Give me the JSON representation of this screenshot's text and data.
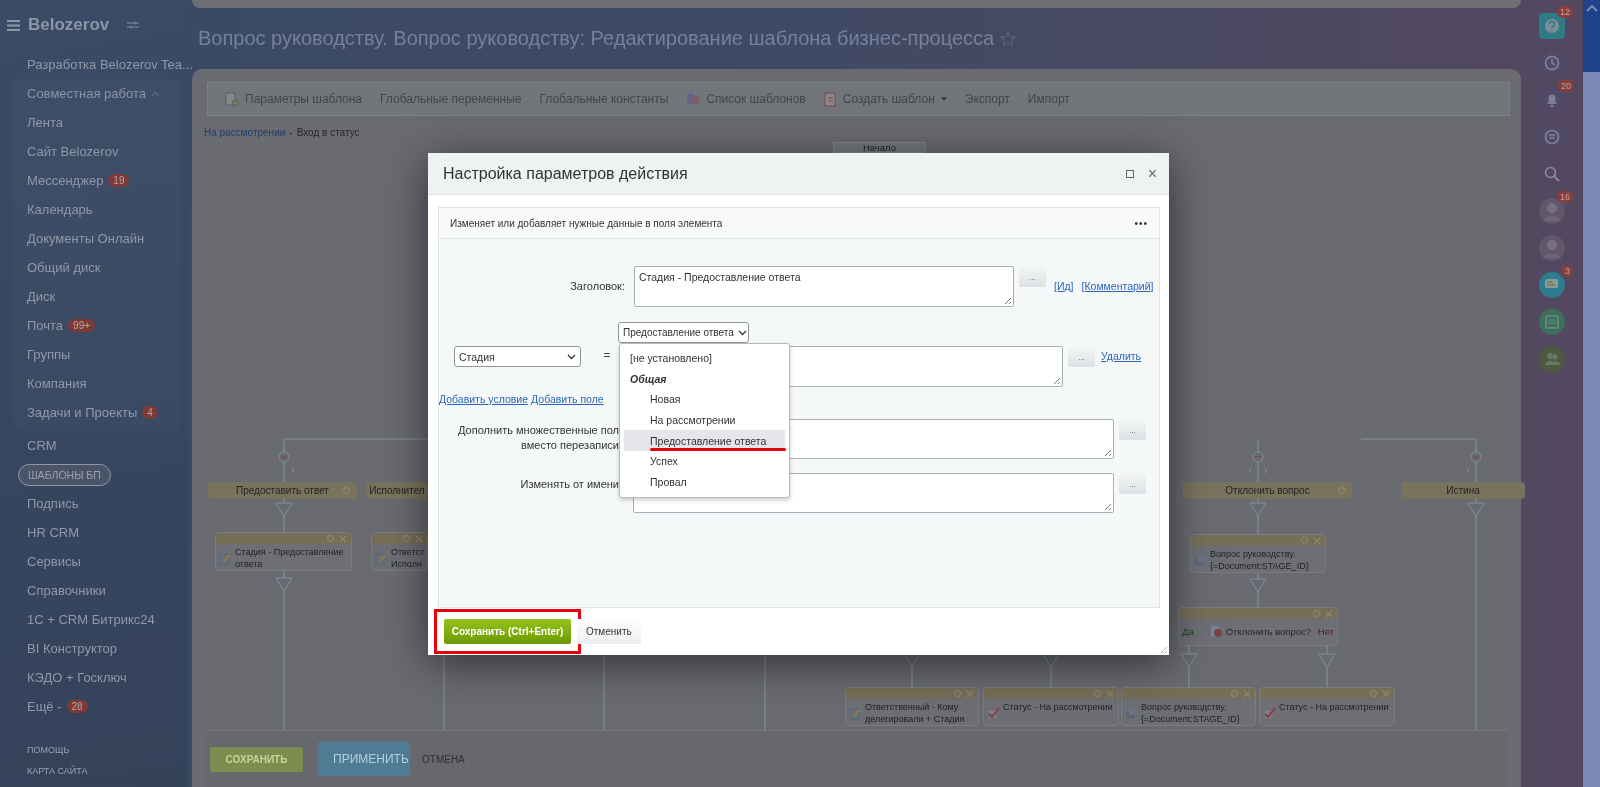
{
  "sidebar": {
    "brand": "Belozerov",
    "items": [
      {
        "label": "Разработка Belozerov Tea...",
        "kind": "item",
        "selected": false
      },
      {
        "label": "Совместная работа",
        "kind": "group",
        "expanded": true,
        "selected": false,
        "children": [
          {
            "label": "Лента",
            "selected": false
          },
          {
            "label": "Сайт Belozerov",
            "selected": false
          },
          {
            "label": "Мессенджер",
            "counter": "19",
            "selected": false
          },
          {
            "label": "Календарь",
            "selected": false
          },
          {
            "label": "Документы Онлайн",
            "selected": false
          },
          {
            "label": "Общий диск",
            "selected": false
          },
          {
            "label": "Диск",
            "selected": false
          },
          {
            "label": "Почта",
            "counter": "99+",
            "selected": false
          },
          {
            "label": "Группы",
            "selected": false
          },
          {
            "label": "Компания",
            "selected": false
          },
          {
            "label": "Задачи и Проекты",
            "counter": "4",
            "selected": false
          }
        ]
      },
      {
        "label": "CRM",
        "kind": "item",
        "selected": false
      },
      {
        "label": "ШАБЛОНЫ БП",
        "kind": "item",
        "selected": true
      },
      {
        "label": "Подпись",
        "kind": "item",
        "selected": false
      },
      {
        "label": "HR CRM",
        "kind": "item",
        "selected": false
      },
      {
        "label": "Сервисы",
        "kind": "item",
        "selected": false
      },
      {
        "label": "Справочники",
        "kind": "item",
        "selected": false
      },
      {
        "label": "1С + CRM Битрикс24",
        "kind": "item",
        "selected": false
      },
      {
        "label": "BI Конструктор",
        "kind": "item",
        "selected": false
      },
      {
        "label": "КЭДО + Госключ",
        "kind": "item",
        "selected": false
      },
      {
        "label": "Ещё -",
        "kind": "item",
        "counter": "28",
        "selected": false
      }
    ],
    "footer": [
      "ПОМОЩЬ",
      "КАРТА САЙТА"
    ]
  },
  "page_title": "Вопрос руководству. Вопрос руководству: Редактирование шаблона бизнес-процесса",
  "toolbar": [
    {
      "label": "Параметры шаблона",
      "kind": "settings"
    },
    {
      "label": "Глобальные переменные",
      "kind": "plain"
    },
    {
      "label": "Глобальные константы",
      "kind": "plain"
    },
    {
      "label": "Список шаблонов",
      "kind": "list"
    },
    {
      "label": "Создать шаблон",
      "kind": "create",
      "dropdown": true
    },
    {
      "label": "Экспорт",
      "kind": "plain"
    },
    {
      "label": "Импорт",
      "kind": "plain"
    }
  ],
  "breadcrumb": {
    "link": "На рассмотрении",
    "separator": "-",
    "current": "Вход в статус"
  },
  "workflow": {
    "nodes": [
      {
        "kind": "start",
        "label": "Начало"
      },
      {
        "kind": "branch",
        "label": "Предоставить ответ",
        "settings": true
      },
      {
        "kind": "branch",
        "label": "Исполнител",
        "settings": false
      },
      {
        "kind": "branch",
        "label": "Отклонить вопрос",
        "settings": true
      },
      {
        "kind": "branch",
        "label": "Истина",
        "settings": false
      },
      {
        "kind": "field-activity",
        "lines": [
          "Стадия - Предоставление",
          "ответа"
        ]
      },
      {
        "kind": "field-activity",
        "lines": [
          "Ответст",
          "Исполн"
        ]
      },
      {
        "kind": "message-activity",
        "lines": [
          "Вопрос руководству.",
          "{=Document:STAGE_ID}"
        ]
      },
      {
        "kind": "ifelse",
        "yes": "Да",
        "label": "Отклонить вопрос?",
        "no": "Нет"
      },
      {
        "kind": "field-activity",
        "lines": [
          "Ответственный - Кому",
          "делегировали + Стадия"
        ]
      },
      {
        "kind": "status-activity",
        "lines": [
          "Статус - На рассмотрении"
        ]
      },
      {
        "kind": "message-activity",
        "lines": [
          "Вопрос руководству.",
          "{=Document:STAGE_ID}"
        ]
      },
      {
        "kind": "status-activity",
        "lines": [
          "Статус - На рассмотрении"
        ]
      }
    ]
  },
  "bottom_bar": [
    {
      "label": "СОХРАНИТЬ",
      "kind": "save"
    },
    {
      "label": "ПРИМЕНИТЬ",
      "kind": "apply"
    },
    {
      "label": "ОТМЕНА",
      "kind": "cancel"
    }
  ],
  "right_bar": [
    {
      "kind": "help",
      "counter": "12"
    },
    {
      "kind": "timeline"
    },
    {
      "kind": "bell",
      "counter": "20"
    },
    {
      "kind": "chats"
    },
    {
      "kind": "search"
    },
    {
      "kind": "avatar",
      "counter": "16"
    },
    {
      "kind": "avatar"
    },
    {
      "kind": "messenger",
      "counter": "3"
    },
    {
      "kind": "news"
    },
    {
      "kind": "people"
    }
  ],
  "dialog": {
    "title": "Настройка параметров действия",
    "close": "×",
    "description": "Изменяет или добавляет нужные данные в поля элемента",
    "menu": "•••",
    "title_field": {
      "label": "Заголовок:",
      "value": "Стадия - Предоставление ответа",
      "button": "...",
      "links": [
        "[Ид]",
        "[Комментарий]"
      ]
    },
    "value_select": "Предоставление ответа",
    "condition": {
      "field": "Стадия",
      "operator": "=",
      "button": "...",
      "remove": "Удалить"
    },
    "add_links": [
      "Добавить условие",
      "Добавить поле"
    ],
    "extra_fields": [
      {
        "label_lines": [
          "Дополнить множественные пол",
          "вместо перезаписи"
        ],
        "button": "..."
      },
      {
        "label_lines": [
          "Изменять от имени"
        ],
        "button": "..."
      }
    ],
    "dropdown": {
      "options": [
        {
          "label": "[не установлено]",
          "kind": "option",
          "selected": false,
          "underlined": false
        },
        {
          "label": "Общая",
          "kind": "group",
          "selected": false,
          "underlined": false
        },
        {
          "label": "Новая",
          "kind": "suboption",
          "selected": false,
          "underlined": false
        },
        {
          "label": "На рассмотрении",
          "kind": "suboption",
          "selected": false,
          "underlined": false
        },
        {
          "label": "Предоставление ответа",
          "kind": "suboption",
          "selected": true,
          "underlined": true
        },
        {
          "label": "Успех",
          "kind": "suboption",
          "selected": false,
          "underlined": false
        },
        {
          "label": "Провал",
          "kind": "suboption",
          "selected": false,
          "underlined": false
        }
      ]
    },
    "save": {
      "label": "Сохранить (Ctrl+Enter)",
      "highlighted": true
    },
    "cancel": "Отменить"
  }
}
